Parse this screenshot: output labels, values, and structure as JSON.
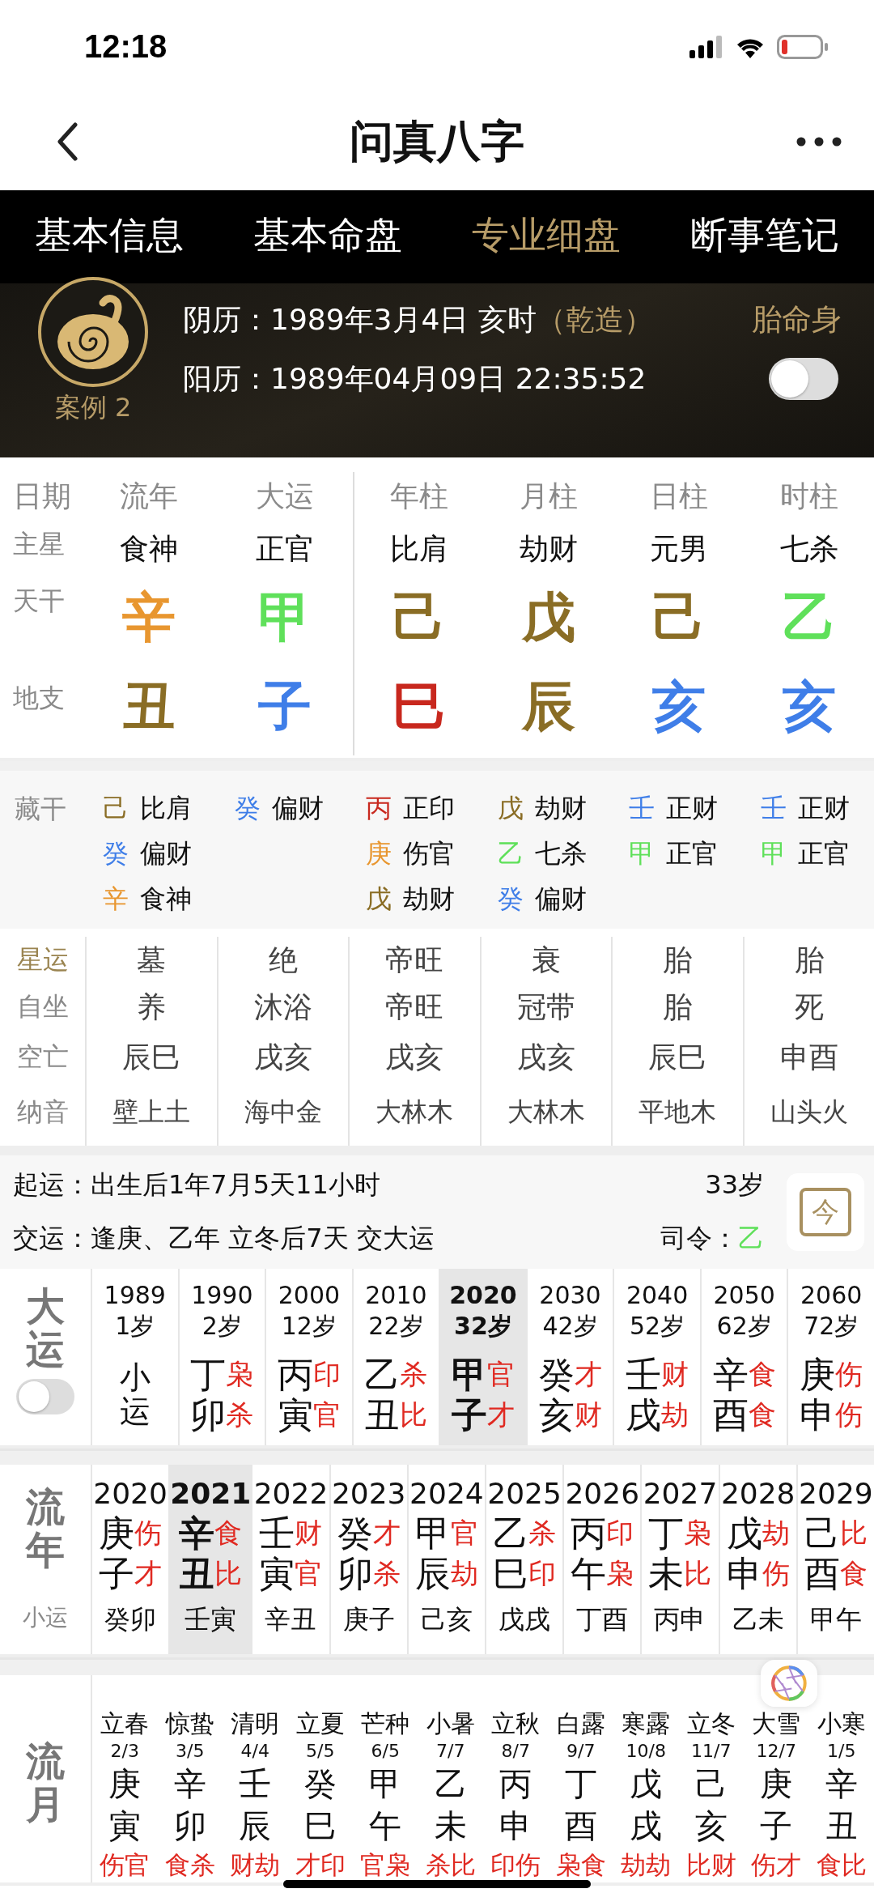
{
  "status_bar": {
    "time": "12:18"
  },
  "nav": {
    "title": "问真八字"
  },
  "tabs": [
    {
      "label": "基本信息",
      "selected": false
    },
    {
      "label": "基本命盘",
      "selected": false
    },
    {
      "label": "专业细盘",
      "selected": true
    },
    {
      "label": "断事笔记",
      "selected": false
    }
  ],
  "profile": {
    "case_label": "案例 2",
    "lunar_label": "阴历：",
    "lunar_date": "1989年3月4日 亥时",
    "gender_note": "（乾造）",
    "extra_link": "胎命身",
    "solar_label": "阳历：",
    "solar_date": "1989年04月09日 22:35:52",
    "toggle_on": false
  },
  "pillars": {
    "row_labels": [
      "日期",
      "主星",
      "天干",
      "地支"
    ],
    "columns": [
      {
        "header": "流年",
        "main_star": "食神",
        "stem": {
          "char": "辛",
          "color": "#e8962f"
        },
        "branch": {
          "char": "丑",
          "color": "#8a6d25"
        }
      },
      {
        "header": "大运",
        "main_star": "正官",
        "stem": {
          "char": "甲",
          "color": "#5fe05a"
        },
        "branch": {
          "char": "子",
          "color": "#3f7ee8"
        }
      },
      {
        "header": "年柱",
        "main_star": "比肩",
        "stem": {
          "char": "己",
          "color": "#8a6d25"
        },
        "branch": {
          "char": "巳",
          "color": "#c8281e"
        }
      },
      {
        "header": "月柱",
        "main_star": "劫财",
        "stem": {
          "char": "戊",
          "color": "#8a6d25"
        },
        "branch": {
          "char": "辰",
          "color": "#8a6d25"
        }
      },
      {
        "header": "日柱",
        "main_star": "元男",
        "stem": {
          "char": "己",
          "color": "#8a6d25"
        },
        "branch": {
          "char": "亥",
          "color": "#3f7ee8"
        }
      },
      {
        "header": "时柱",
        "main_star": "七杀",
        "stem": {
          "char": "乙",
          "color": "#5fe05a"
        },
        "branch": {
          "char": "亥",
          "color": "#3f7ee8"
        }
      }
    ]
  },
  "hidden_stems": {
    "label": "藏干",
    "columns": [
      [
        {
          "stem": "己",
          "color": "#8a6d25",
          "god": "比肩"
        },
        {
          "stem": "癸",
          "color": "#3f7ee8",
          "god": "偏财"
        },
        {
          "stem": "辛",
          "color": "#e8962f",
          "god": "食神"
        }
      ],
      [
        {
          "stem": "癸",
          "color": "#3f7ee8",
          "god": "偏财"
        }
      ],
      [
        {
          "stem": "丙",
          "color": "#c8281e",
          "god": "正印"
        },
        {
          "stem": "庚",
          "color": "#e8962f",
          "god": "伤官"
        },
        {
          "stem": "戊",
          "color": "#8a6d25",
          "god": "劫财"
        }
      ],
      [
        {
          "stem": "戊",
          "color": "#8a6d25",
          "god": "劫财"
        },
        {
          "stem": "乙",
          "color": "#5fe05a",
          "god": "七杀"
        },
        {
          "stem": "癸",
          "color": "#3f7ee8",
          "god": "偏财"
        }
      ],
      [
        {
          "stem": "壬",
          "color": "#3f7ee8",
          "god": "正财"
        },
        {
          "stem": "甲",
          "color": "#5fe05a",
          "god": "正官"
        }
      ],
      [
        {
          "stem": "壬",
          "color": "#3f7ee8",
          "god": "正财"
        },
        {
          "stem": "甲",
          "color": "#5fe05a",
          "god": "正官"
        }
      ]
    ]
  },
  "stats": [
    {
      "label": "星运",
      "active": true,
      "values": [
        "墓",
        "绝",
        "帝旺",
        "衰",
        "胎",
        "胎"
      ]
    },
    {
      "label": "自坐",
      "active": false,
      "values": [
        "养",
        "沐浴",
        "帝旺",
        "冠带",
        "胎",
        "死"
      ]
    },
    {
      "label": "空亡",
      "active": false,
      "values": [
        "辰巳",
        "戌亥",
        "戌亥",
        "戌亥",
        "辰巳",
        "申酉"
      ]
    },
    {
      "label": "纳音",
      "active": false,
      "values": [
        "壁上土",
        "海中金",
        "大林木",
        "大林木",
        "平地木",
        "山头火"
      ]
    }
  ],
  "qiyun": {
    "start_label": "起运：",
    "start_text": "出生后1年7月5天11小时",
    "age": "33岁",
    "jiao_label": "交运：",
    "jiao_text": "逢庚、乙年 立冬后7天 交大运",
    "siling_label": "司令：",
    "siling_value": "乙",
    "calendar_glyph": "今"
  },
  "dayun": {
    "label": "大运",
    "toggle_on": false,
    "items": [
      {
        "kind": "minor",
        "year": "1989",
        "age": "1岁",
        "text": "小运",
        "selected": false
      },
      {
        "kind": "pillar",
        "year": "1990",
        "age": "2岁",
        "stem": "丁",
        "branch": "卯",
        "stem_god": "枭",
        "branch_god": "杀",
        "selected": false
      },
      {
        "kind": "pillar",
        "year": "2000",
        "age": "12岁",
        "stem": "丙",
        "branch": "寅",
        "stem_god": "印",
        "branch_god": "官",
        "selected": false
      },
      {
        "kind": "pillar",
        "year": "2010",
        "age": "22岁",
        "stem": "乙",
        "branch": "丑",
        "stem_god": "杀",
        "branch_god": "比",
        "selected": false
      },
      {
        "kind": "pillar",
        "year": "2020",
        "age": "32岁",
        "stem": "甲",
        "branch": "子",
        "stem_god": "官",
        "branch_god": "才",
        "selected": true
      },
      {
        "kind": "pillar",
        "year": "2030",
        "age": "42岁",
        "stem": "癸",
        "branch": "亥",
        "stem_god": "才",
        "branch_god": "财",
        "selected": false
      },
      {
        "kind": "pillar",
        "year": "2040",
        "age": "52岁",
        "stem": "壬",
        "branch": "戌",
        "stem_god": "财",
        "branch_god": "劫",
        "selected": false
      },
      {
        "kind": "pillar",
        "year": "2050",
        "age": "62岁",
        "stem": "辛",
        "branch": "酉",
        "stem_god": "食",
        "branch_god": "食",
        "selected": false
      },
      {
        "kind": "pillar",
        "year": "2060",
        "age": "72岁",
        "stem": "庚",
        "branch": "申",
        "stem_god": "伤",
        "branch_god": "伤",
        "selected": false
      }
    ]
  },
  "liunian": {
    "label": "流年",
    "sub_label": "小运",
    "items": [
      {
        "year": "2020",
        "stem": "庚",
        "branch": "子",
        "stem_god": "伤",
        "branch_god": "才",
        "xiaoyun": "癸卯",
        "selected": false
      },
      {
        "year": "2021",
        "stem": "辛",
        "branch": "丑",
        "stem_god": "食",
        "branch_god": "比",
        "xiaoyun": "壬寅",
        "selected": true
      },
      {
        "year": "2022",
        "stem": "壬",
        "branch": "寅",
        "stem_god": "财",
        "branch_god": "官",
        "xiaoyun": "辛丑",
        "selected": false
      },
      {
        "year": "2023",
        "stem": "癸",
        "branch": "卯",
        "stem_god": "才",
        "branch_god": "杀",
        "xiaoyun": "庚子",
        "selected": false
      },
      {
        "year": "2024",
        "stem": "甲",
        "branch": "辰",
        "stem_god": "官",
        "branch_god": "劫",
        "xiaoyun": "己亥",
        "selected": false
      },
      {
        "year": "2025",
        "stem": "乙",
        "branch": "巳",
        "stem_god": "杀",
        "branch_god": "印",
        "xiaoyun": "戊戌",
        "selected": false
      },
      {
        "year": "2026",
        "stem": "丙",
        "branch": "午",
        "stem_god": "印",
        "branch_god": "枭",
        "xiaoyun": "丁酉",
        "selected": false
      },
      {
        "year": "2027",
        "stem": "丁",
        "branch": "未",
        "stem_god": "枭",
        "branch_god": "比",
        "xiaoyun": "丙申",
        "selected": false
      },
      {
        "year": "2028",
        "stem": "戊",
        "branch": "申",
        "stem_god": "劫",
        "branch_god": "伤",
        "xiaoyun": "乙未",
        "selected": false
      },
      {
        "year": "2029",
        "stem": "己",
        "branch": "酉",
        "stem_god": "比",
        "branch_god": "食",
        "xiaoyun": "甲午",
        "selected": false
      }
    ]
  },
  "liuyue": {
    "label": "流月",
    "items": [
      {
        "term": "立春",
        "date": "2/3",
        "stem": "庚",
        "branch": "寅",
        "gods": "伤官"
      },
      {
        "term": "惊蛰",
        "date": "3/5",
        "stem": "辛",
        "branch": "卯",
        "gods": "食杀"
      },
      {
        "term": "清明",
        "date": "4/4",
        "stem": "壬",
        "branch": "辰",
        "gods": "财劫"
      },
      {
        "term": "立夏",
        "date": "5/5",
        "stem": "癸",
        "branch": "巳",
        "gods": "才印"
      },
      {
        "term": "芒种",
        "date": "6/5",
        "stem": "甲",
        "branch": "午",
        "gods": "官枭"
      },
      {
        "term": "小暑",
        "date": "7/7",
        "stem": "乙",
        "branch": "未",
        "gods": "杀比"
      },
      {
        "term": "立秋",
        "date": "8/7",
        "stem": "丙",
        "branch": "申",
        "gods": "印伤"
      },
      {
        "term": "白露",
        "date": "9/7",
        "stem": "丁",
        "branch": "酉",
        "gods": "枭食"
      },
      {
        "term": "寒露",
        "date": "10/8",
        "stem": "戊",
        "branch": "戌",
        "gods": "劫劫"
      },
      {
        "term": "立冬",
        "date": "11/7",
        "stem": "己",
        "branch": "亥",
        "gods": "比财"
      },
      {
        "term": "大雪",
        "date": "12/7",
        "stem": "庚",
        "branch": "子",
        "gods": "伤才"
      },
      {
        "term": "小寒",
        "date": "1/5",
        "stem": "辛",
        "branch": "丑",
        "gods": "食比"
      }
    ]
  }
}
